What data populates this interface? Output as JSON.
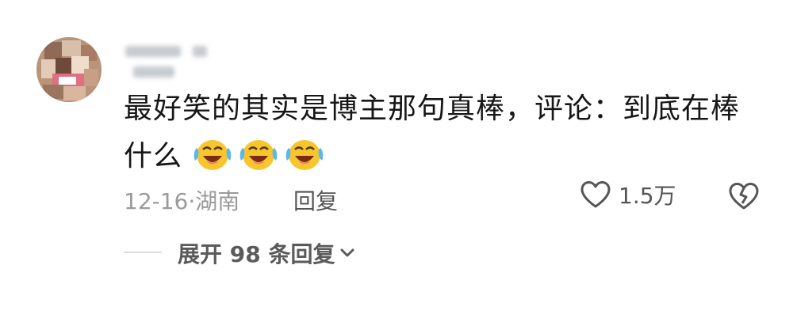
{
  "comment": {
    "username": "",
    "text_line1": "最好笑的其实是博主那句真棒，评论：到底在棒",
    "text_line2": "什么",
    "emojis": [
      "crying-laughing-emoji",
      "crying-laughing-emoji",
      "crying-laughing-emoji"
    ],
    "date_location": "12-16·湖南",
    "reply_label": "回复",
    "like_count": "1.5万",
    "expand_replies_label": "展开 98 条回复"
  },
  "icons": {
    "like": "heart-outline-icon",
    "dislike": "broken-heart-icon",
    "expand": "chevron-down-icon"
  },
  "colors": {
    "text": "#161616",
    "meta": "#9a9a9a",
    "emoji_face": "#f7c62f"
  }
}
